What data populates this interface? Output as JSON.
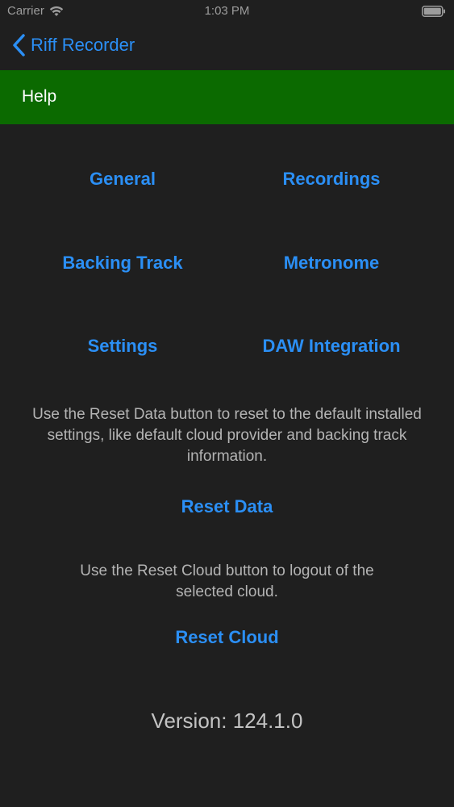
{
  "status_bar": {
    "carrier": "Carrier",
    "time": "1:03 PM",
    "icons": [
      "wifi-icon",
      "battery-icon"
    ]
  },
  "nav": {
    "back_label": "Riff Recorder",
    "back_icon": "chevron-left-icon"
  },
  "header": {
    "title": "Help"
  },
  "topics": {
    "general": "General",
    "recordings": "Recordings",
    "backing_track": "Backing Track",
    "metronome": "Metronome",
    "settings": "Settings",
    "daw_integration": "DAW Integration"
  },
  "reset_data": {
    "description": "Use the Reset Data button to reset to the default installed settings, like default cloud provider and backing track information.",
    "button": "Reset Data"
  },
  "reset_cloud": {
    "description": "Use the Reset Cloud button to logout of the selected cloud.",
    "button": "Reset Cloud"
  },
  "version": "Version: 124.1.0",
  "colors": {
    "background": "#1f1f1f",
    "header": "#0b6a00",
    "link": "#2b8ff5",
    "body_text": "#b4b4b4"
  }
}
